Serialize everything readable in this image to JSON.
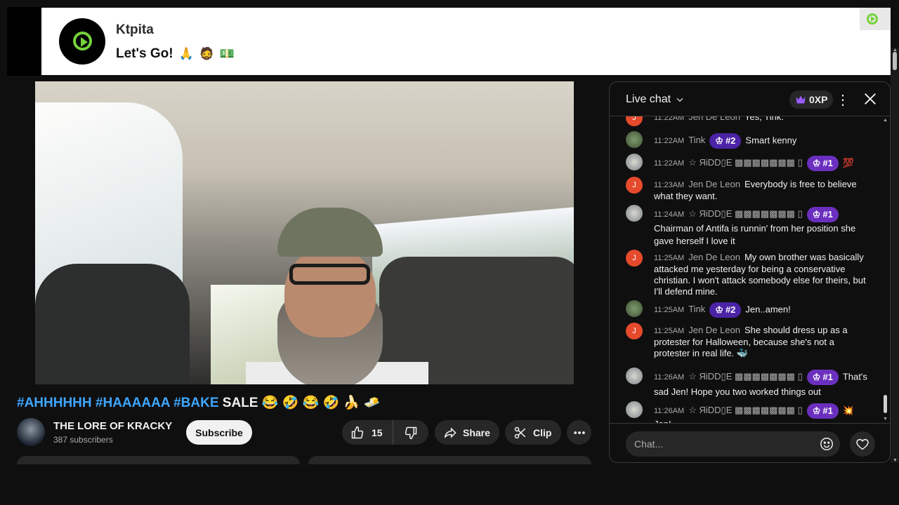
{
  "banner": {
    "username": "Ktpita",
    "message": "Let's Go!",
    "message_emojis": [
      "🙏",
      "🧔",
      "💵"
    ]
  },
  "video": {
    "title_tags": [
      "#AHHHHHH",
      "#HAAAAAA",
      "#BAKE"
    ],
    "title_text": "SALE",
    "title_emojis": "😂 🤣 😂 🤣 🍌 🧈"
  },
  "channel": {
    "name": "THE LORE OF KRACKY",
    "subscribers": "387 subscribers",
    "subscribe_label": "Subscribe"
  },
  "actions": {
    "like_count": "15",
    "share_label": "Share",
    "clip_label": "Clip"
  },
  "chat": {
    "title": "Live chat",
    "xp": "0XP",
    "input_placeholder": "Chat...",
    "messages": [
      {
        "time": "11:22AM",
        "author": "Jen De Leon",
        "avatar": "J",
        "text": "Yes, Tink."
      },
      {
        "time": "11:22AM",
        "author": "Tink",
        "rank": "#2",
        "text": "Smart kenny"
      },
      {
        "time": "11:22AM",
        "author": "☆ ЯiDD▯E ▩▩▩▩▩▩▩ ▯",
        "rank": "#1",
        "text": "💯"
      },
      {
        "time": "11:23AM",
        "author": "Jen De Leon",
        "avatar": "J",
        "text": "Everybody is free to believe what they want."
      },
      {
        "time": "11:24AM",
        "author": "☆ ЯiDD▯E ▩▩▩▩▩▩▩ ▯",
        "rank": "#1",
        "text": "Chairman of Antifa is runnin' from her position she gave herself I love it"
      },
      {
        "time": "11:25AM",
        "author": "Jen De Leon",
        "avatar": "J",
        "text": "My own brother was basically attacked me yesterday for being a conservative christian. I won't attack somebody else for theirs, but I'll defend mine."
      },
      {
        "time": "11:25AM",
        "author": "Tink",
        "rank": "#2",
        "text": "Jen..amen!"
      },
      {
        "time": "11:25AM",
        "author": "Jen De Leon",
        "avatar": "J",
        "text": "She should dress up as a protester for Halloween, because she's not a protester in real life. 🐳"
      },
      {
        "time": "11:26AM",
        "author": "☆ ЯiDD▯E ▩▩▩▩▩▩▩ ▯",
        "rank": "#1",
        "text": "That's sad Jen! Hope you two worked things out"
      },
      {
        "time": "11:26AM",
        "author": "☆ ЯiDD▯E ▩▩▩▩▩▩▩ ▯",
        "rank": "#1",
        "text": "💥 Jen!"
      }
    ]
  },
  "colors": {
    "accent_link": "#3ea6ff",
    "rank_purple": "#6b2fbf",
    "brand_green": "#75d23b"
  }
}
